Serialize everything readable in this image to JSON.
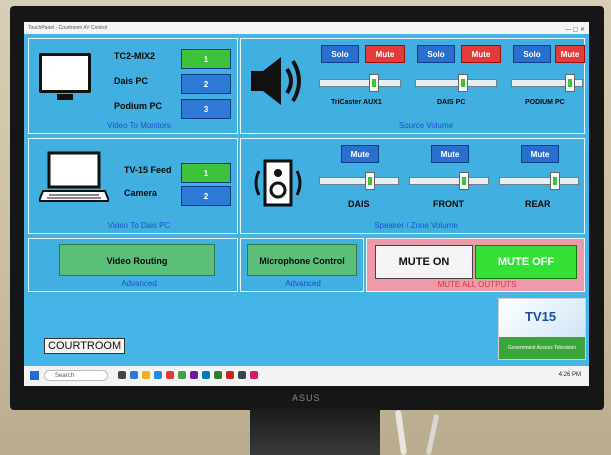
{
  "window": {
    "title": "TouchPanel - Courtroom AV Control"
  },
  "monitors": {
    "sources": [
      {
        "label": "TC2-MIX2",
        "num": "1",
        "active": true
      },
      {
        "label": "Dais PC",
        "num": "2",
        "active": false
      },
      {
        "label": "Podium PC",
        "num": "3",
        "active": false
      }
    ],
    "caption": "Video To Monitors"
  },
  "source_volume": {
    "channels": [
      {
        "name": "TriCaster AUX1",
        "solo": "Solo",
        "mute": "Mute",
        "level": 0.7
      },
      {
        "name": "DAIS PC",
        "solo": "Solo",
        "mute": "Mute",
        "level": 0.6
      },
      {
        "name": "PODIUM PC",
        "solo": "Solo",
        "mute": "Mute",
        "level": 0.88
      }
    ],
    "caption": "Source Volume"
  },
  "dais": {
    "sources": [
      {
        "label": "TV-15 Feed",
        "num": "1",
        "active": true
      },
      {
        "label": "Camera",
        "num": "2",
        "active": false
      }
    ],
    "caption": "Video To Dais PC"
  },
  "zone_volume": {
    "zones": [
      {
        "name": "DAIS",
        "mute": "Mute",
        "level": 0.66
      },
      {
        "name": "FRONT",
        "mute": "Mute",
        "level": 0.72
      },
      {
        "name": "REAR",
        "mute": "Mute",
        "level": 0.74
      }
    ],
    "caption": "Speaker / Zone Volume"
  },
  "routing": {
    "button": "Video Routing",
    "caption": "Advanced"
  },
  "mic": {
    "button": "Microphone Control",
    "caption": "Advanced"
  },
  "outputs": {
    "mute_on": "MUTE ON",
    "mute_off": "MUTE OFF",
    "caption": "MUTE ALL OUTPUTS"
  },
  "room": {
    "name": "COURTROOM"
  },
  "logo": {
    "text": "TV15",
    "tagline": "Government Access Television"
  },
  "taskbar": {
    "search": "Search",
    "time": "4:26 PM"
  },
  "monitor_brand": "ASUS",
  "colors": {
    "panel": "#41b0e1",
    "active": "#3fc23b",
    "inactive": "#2f7ad6",
    "mute": "#e43a3a"
  }
}
